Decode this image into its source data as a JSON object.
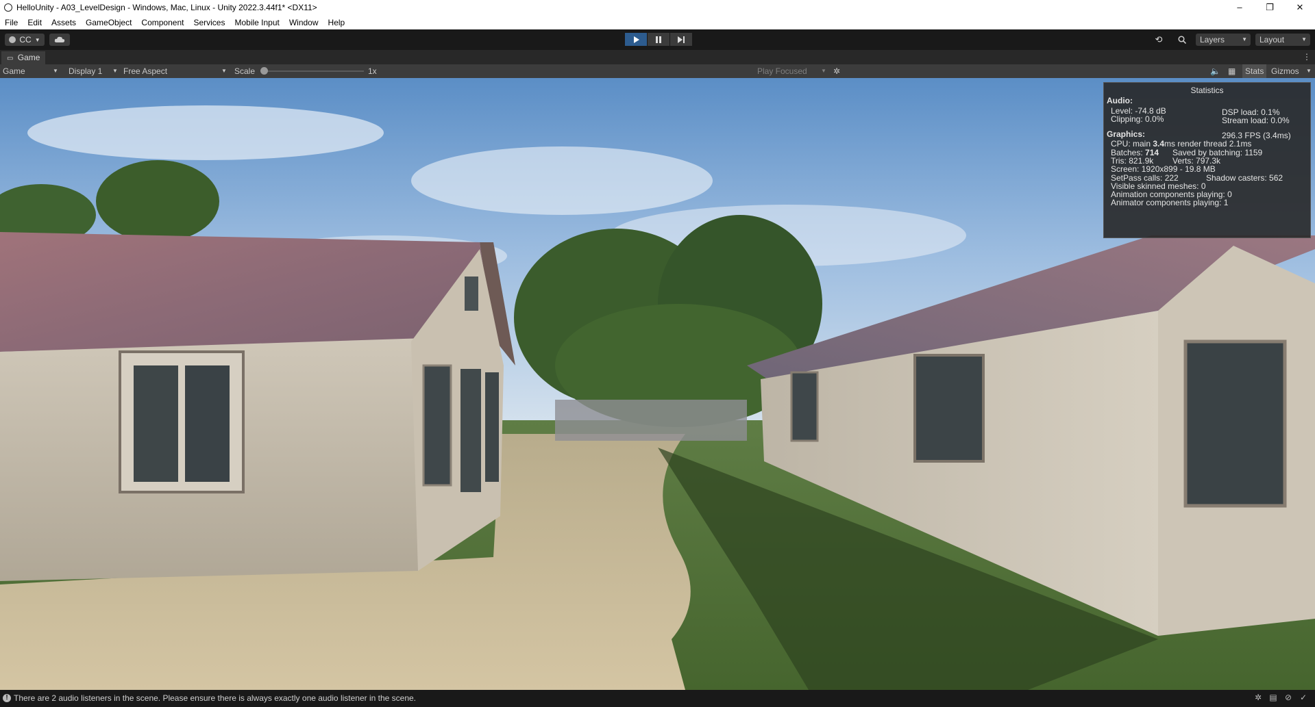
{
  "window": {
    "title": "HelloUnity - A03_LevelDesign - Windows, Mac, Linux - Unity 2022.3.44f1* <DX11>",
    "controls": [
      "–",
      "❐",
      "✕"
    ]
  },
  "menu": [
    "File",
    "Edit",
    "Assets",
    "GameObject",
    "Component",
    "Services",
    "Mobile Input",
    "Window",
    "Help"
  ],
  "toolbar": {
    "account_label": "CC",
    "layers_label": "Layers",
    "layout_label": "Layout",
    "play_state": "playing"
  },
  "tab": {
    "label": "Game"
  },
  "gamebar": {
    "view_mode": "Game",
    "display": "Display 1",
    "aspect": "Free Aspect",
    "scale_label": "Scale",
    "scale_value": "1x",
    "play_focused": "Play Focused",
    "stats_label": "Stats",
    "gizmos_label": "Gizmos"
  },
  "stats": {
    "title": "Statistics",
    "audio_header": "Audio:",
    "level": "Level: -74.8 dB",
    "clipping": "Clipping: 0.0%",
    "dsp": "DSP load: 0.1%",
    "stream": "Stream load: 0.0%",
    "graphics_header": "Graphics:",
    "fps": "296.3 FPS (3.4ms)",
    "cpu_prefix": "CPU: main ",
    "cpu_main": "3.4",
    "cpu_suffix": "ms  render thread 2.1ms",
    "batches_prefix": "Batches: ",
    "batches": "714",
    "saved_batching": "Saved by batching: 1159",
    "tris": "Tris: 821.9k",
    "verts": "Verts: 797.3k",
    "screen": "Screen: 1920x899 - 19.8 MB",
    "setpass": "SetPass calls: 222",
    "shadow_casters": "Shadow casters: 562",
    "skinned": "Visible skinned meshes: 0",
    "animation": "Animation components playing: 0",
    "animator": "Animator components playing: 1"
  },
  "status": {
    "message": "There are 2 audio listeners in the scene. Please ensure there is always exactly one audio listener in the scene."
  }
}
